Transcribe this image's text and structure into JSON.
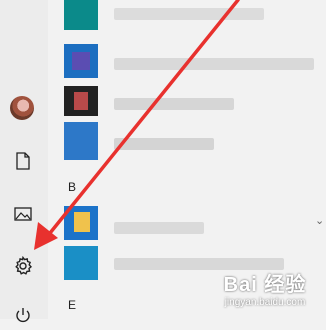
{
  "start_menu": {
    "rail": {
      "items": [
        {
          "name": "avatar",
          "icon": "user-avatar"
        },
        {
          "name": "documents",
          "icon": "document-icon"
        },
        {
          "name": "pictures",
          "icon": "image-icon"
        },
        {
          "name": "settings",
          "icon": "gear-icon"
        },
        {
          "name": "power",
          "icon": "power-icon"
        }
      ]
    },
    "app_list": {
      "section_b": "B",
      "section_e": "E",
      "scroll_indicator": "⌄"
    }
  },
  "annotation": {
    "arrow_color": "#e8312e"
  },
  "watermark": {
    "logo_text": "Bai 经验",
    "site": "jingyan.baidu.com"
  }
}
